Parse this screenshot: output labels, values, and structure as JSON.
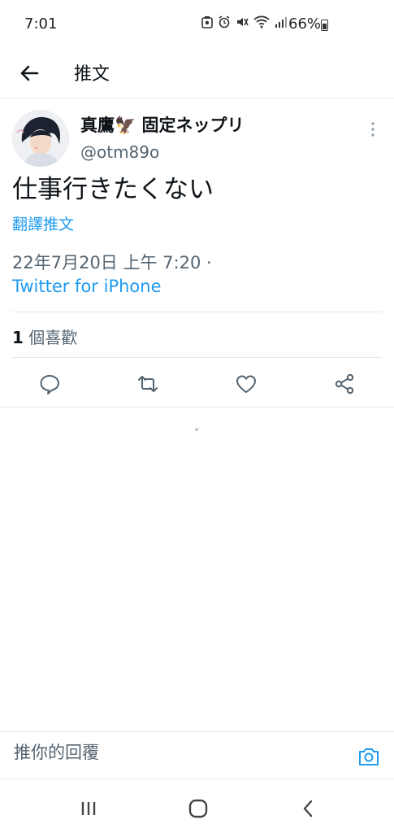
{
  "status_bar": {
    "time": "7:01",
    "battery": "66%",
    "icons": [
      "whatsapp-icon",
      "alarm-icon",
      "mute-icon",
      "wifi-icon",
      "signal-icon",
      "battery-icon"
    ]
  },
  "header": {
    "title": "推文"
  },
  "tweet": {
    "author_name": "真鷹🦅 固定ネップリ",
    "author_handle": "@otm89o",
    "text": "仕事行きたくない",
    "translate_label": "翻譯推文",
    "timestamp": "22年7月20日 上午 7:20 ·",
    "source": "Twitter for iPhone",
    "likes_count": "1",
    "likes_label": "個喜歡"
  },
  "reply": {
    "placeholder": "推你的回覆"
  },
  "colors": {
    "accent": "#1d9bf0",
    "text": "#0f1419",
    "muted": "#536471",
    "divider": "#e7e7e7"
  }
}
